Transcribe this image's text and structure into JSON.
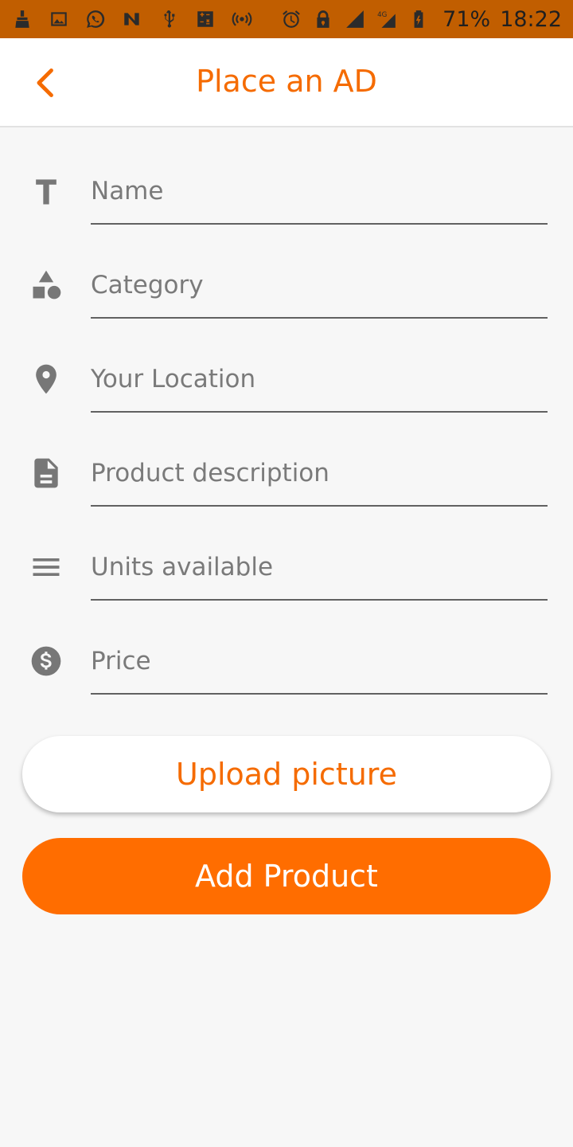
{
  "status_bar": {
    "battery": "71%",
    "time": "18:22",
    "network": "4G",
    "icons": [
      "cleaner-icon",
      "image-icon",
      "whatsapp-icon",
      "n-icon",
      "usb-icon",
      "calculator-icon",
      "hotspot-icon",
      "alarm-icon",
      "lock-icon",
      "signal-icon",
      "signal-4g-icon",
      "battery-icon"
    ]
  },
  "app_bar": {
    "title": "Place an AD",
    "back_icon": "chevron-left-icon"
  },
  "form": {
    "fields": [
      {
        "icon": "text-icon",
        "placeholder": "Name",
        "value": ""
      },
      {
        "icon": "category-shapes-icon",
        "placeholder": "Category",
        "value": ""
      },
      {
        "icon": "location-pin-icon",
        "placeholder": "Your Location",
        "value": ""
      },
      {
        "icon": "document-icon",
        "placeholder": "Product description",
        "value": ""
      },
      {
        "icon": "list-lines-icon",
        "placeholder": "Units available",
        "value": ""
      },
      {
        "icon": "dollar-icon",
        "placeholder": "Price",
        "value": ""
      }
    ]
  },
  "buttons": {
    "upload_label": "Upload picture",
    "add_label": "Add Product"
  },
  "colors": {
    "accent": "#f56b00",
    "primary_button": "#ff6d00",
    "status_bar": "#c15e00",
    "icon_gray": "#777777"
  }
}
